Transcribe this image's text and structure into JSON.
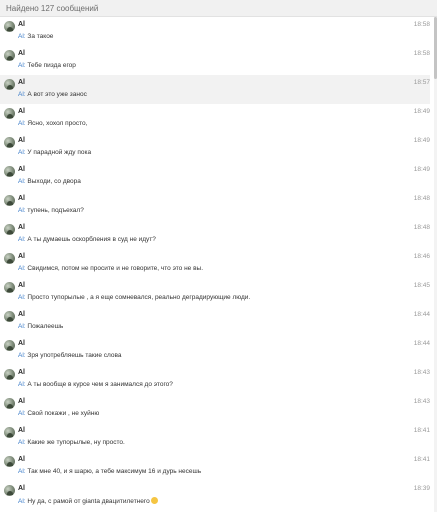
{
  "search": {
    "result_count_label": "Найдено 127 сообщений"
  },
  "messages": [
    {
      "name": "Al",
      "time": "18:58",
      "from": "Al:",
      "text": "За такое"
    },
    {
      "name": "Al",
      "time": "18:58",
      "from": "Al:",
      "text": "Тебе пизда егор"
    },
    {
      "name": "Al",
      "time": "18:57",
      "from": "Al:",
      "text": "А вот это уже заноc"
    },
    {
      "name": "Al",
      "time": "18:49",
      "from": "Al:",
      "text": "Ясно, хохол просто,"
    },
    {
      "name": "Al",
      "time": "18:49",
      "from": "Al:",
      "text": "У парадной жду пока"
    },
    {
      "name": "Al",
      "time": "18:49",
      "from": "Al:",
      "text": "Выходи, со двора"
    },
    {
      "name": "Al",
      "time": "18:48",
      "from": "Al:",
      "text": "тупень, подъехал?"
    },
    {
      "name": "Al",
      "time": "18:48",
      "from": "Al:",
      "text": "А ты думаешь оскорбления в суд не идут?"
    },
    {
      "name": "Al",
      "time": "18:46",
      "from": "Al:",
      "text": "Свидимся, потом не просите и не говорите, что это не вы."
    },
    {
      "name": "Al",
      "time": "18:45",
      "from": "Al:",
      "text": "Просто тупорылые , а я еще сомневался, реально деградирующие люди."
    },
    {
      "name": "Al",
      "time": "18:44",
      "from": "Al:",
      "text": "Пожалеешь"
    },
    {
      "name": "Al",
      "time": "18:44",
      "from": "Al:",
      "text": "Зря употребляешь такие слова"
    },
    {
      "name": "Al",
      "time": "18:43",
      "from": "Al:",
      "text": "А ты вообще в курсе чем я занимался до этого?"
    },
    {
      "name": "Al",
      "time": "18:43",
      "from": "Al:",
      "text": "Свой покажи , не хуйню"
    },
    {
      "name": "Al",
      "time": "18:41",
      "from": "Al:",
      "text": "Какие же тупорылые, ну просто."
    },
    {
      "name": "Al",
      "time": "18:41",
      "from": "Al:",
      "text": "Так мне 40, и я шарю, а тебе максимум 16 и дурь несешь"
    },
    {
      "name": "Al",
      "time": "18:39",
      "from": "Al:",
      "text": "Ну да, с рамой от gianta двацитилетнего"
    }
  ]
}
